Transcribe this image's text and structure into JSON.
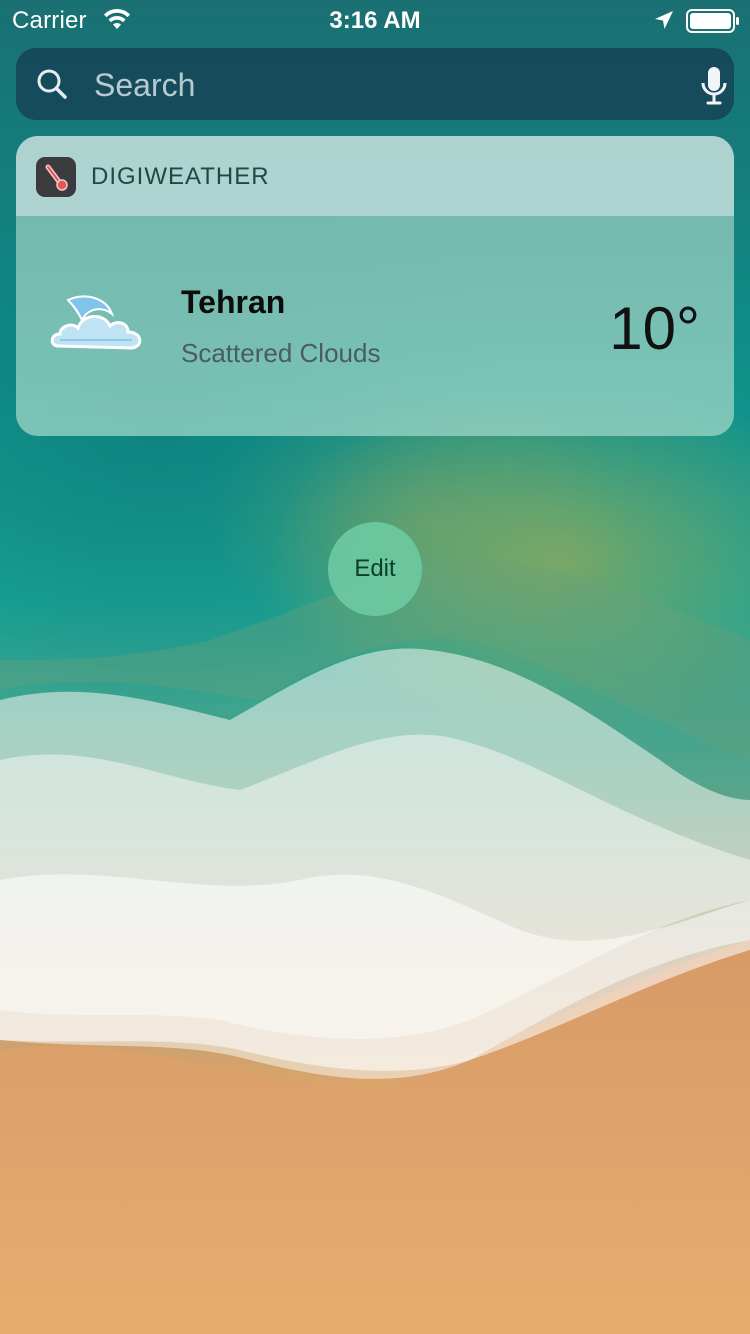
{
  "status_bar": {
    "carrier": "Carrier",
    "time": "3:16 AM",
    "icons": [
      "wifi-icon",
      "location-arrow-icon",
      "battery-icon"
    ]
  },
  "search": {
    "placeholder": "Search",
    "icons": [
      "search-icon",
      "microphone-icon"
    ]
  },
  "widget": {
    "app_name": "DIGIWEATHER",
    "app_icon": "thermometer-icon",
    "city": "Tehran",
    "condition": "Scattered Clouds",
    "temperature": "10°",
    "weather_icon": "moon-cloud-icon"
  },
  "edit_button": {
    "label": "Edit"
  },
  "colors": {
    "ocean": "#0f8c86",
    "sand": "#e3aa6c",
    "widget_tint": "#a5d7cd",
    "edit_button": "#6ecda5"
  }
}
